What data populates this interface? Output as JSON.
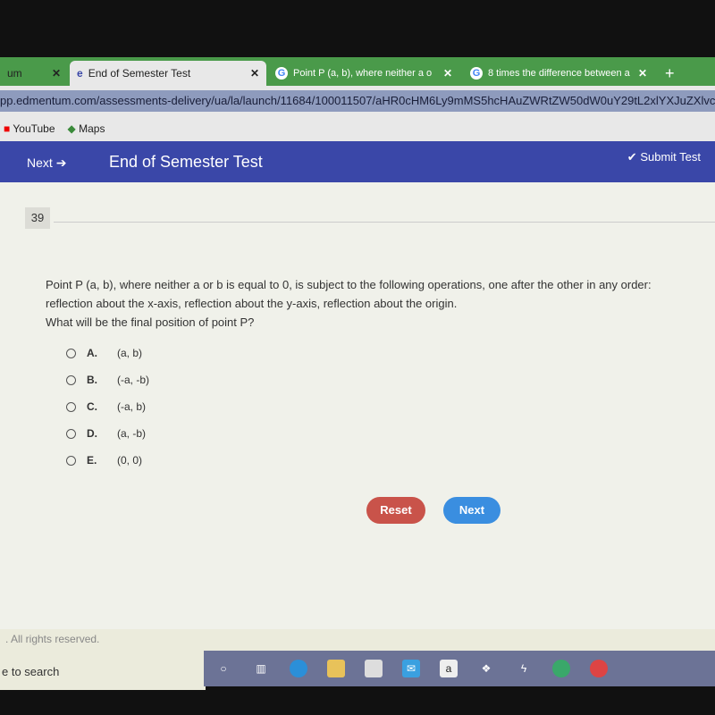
{
  "browser": {
    "tabs": [
      {
        "label": "um"
      },
      {
        "label": "End of Semester Test"
      },
      {
        "label": "Point P (a, b), where neither a or"
      },
      {
        "label": "8 times the difference between a"
      }
    ],
    "url": "pp.edmentum.com/assessments-delivery/ua/la/launch/11684/100011507/aHR0cHM6Ly9mMS5hcHAuZWRtZW50dW0uY29tL2xlYXJuZXlvc2Vjb",
    "bookmarks": [
      "YouTube",
      "Maps"
    ]
  },
  "header": {
    "next": "Next",
    "title": "End of Semester Test",
    "submit": "Submit Test"
  },
  "question": {
    "number": "39",
    "text": "Point P (a, b), where neither a or b is equal to 0, is subject to the following operations, one after the other in any order: reflection about the x-axis, reflection about the y-axis, reflection about the origin.",
    "prompt": "What will be the final position of point P?",
    "options": [
      {
        "letter": "A.",
        "value": "(a, b)"
      },
      {
        "letter": "B.",
        "value": "(-a, -b)"
      },
      {
        "letter": "C.",
        "value": "(-a, b)"
      },
      {
        "letter": "D.",
        "value": "(a, -b)"
      },
      {
        "letter": "E.",
        "value": "(0, 0)"
      }
    ]
  },
  "buttons": {
    "reset": "Reset",
    "next": "Next"
  },
  "footer": {
    "copyright": ". All rights reserved."
  },
  "taskbar": {
    "search": "e to search"
  },
  "colors": {
    "header": "#3a47a8",
    "reset": "#c9534a",
    "next": "#3a8ee0"
  }
}
